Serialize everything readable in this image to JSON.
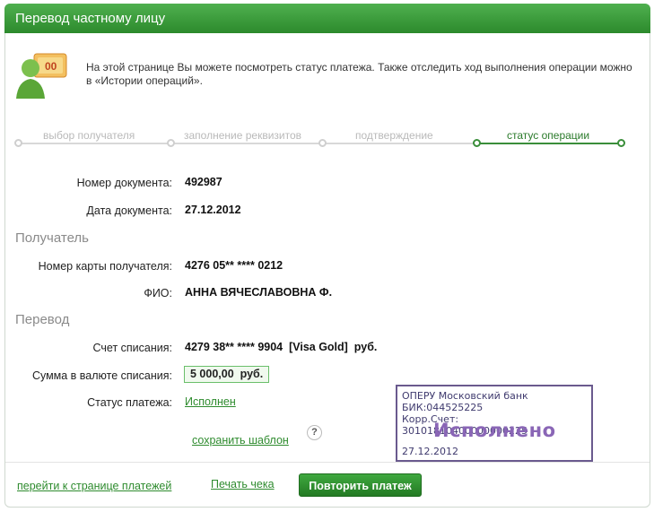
{
  "header": {
    "title": "Перевод частному лицу"
  },
  "intro": {
    "text": "На этой странице Вы можете посмотреть статус платежа. Также отследить ход выполнения операции можно в «Истории операций»."
  },
  "steps": [
    {
      "label": "выбор получателя",
      "active": false
    },
    {
      "label": "заполнение реквизитов",
      "active": false
    },
    {
      "label": "подтверждение",
      "active": false
    },
    {
      "label": "статус операции",
      "active": true
    }
  ],
  "document": {
    "number_label": "Номер документа:",
    "number": "492987",
    "date_label": "Дата документа:",
    "date": "27.12.2012"
  },
  "recipient": {
    "section": "Получатель",
    "card_label": "Номер карты получателя:",
    "card": "4276 05** **** 0212",
    "name_label": "ФИО:",
    "name": "АННА ВЯЧЕСЛАВОВНА Ф."
  },
  "transfer": {
    "section": "Перевод",
    "account_label": "Счет списания:",
    "account": "4279 38** **** 9904  [Visa Gold]  руб.",
    "amount_label": "Сумма в валюте списания:",
    "amount": "5 000,00  руб.",
    "status_label": "Статус платежа:",
    "status": "Исполнен"
  },
  "links": {
    "save_template": "сохранить шаблон",
    "help": "?",
    "to_payments": "перейти к странице платежей",
    "print_check": "Печать чека"
  },
  "buttons": {
    "repeat": "Повторить платеж"
  },
  "stamp": {
    "bank": "ОПЕРУ Московский банк",
    "bik": "БИК:044525225",
    "corr": "Корр.Счет: 30101810400000000225",
    "status": "Исполнено",
    "date": "27.12.2012"
  },
  "colors": {
    "accent": "#2e8b2e",
    "header": "#3a9a3a",
    "stamp": "#6a5a8e"
  }
}
